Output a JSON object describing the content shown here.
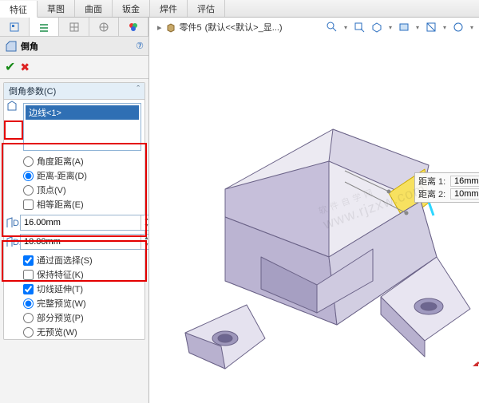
{
  "tabs": {
    "items": [
      "特征",
      "草图",
      "曲面",
      "钣金",
      "焊件",
      "评估"
    ],
    "active_index": 0
  },
  "pm": {
    "title": "倒角",
    "ok_tip": "OK",
    "cancel_tip": "Cancel",
    "help_char": "⑦",
    "group_header": "倒角参数(C)",
    "selection": {
      "items": [
        "边线<1>"
      ]
    },
    "type_options": {
      "angle_dist": "角度距离(A)",
      "dist_dist": "距离-距离(D)",
      "vertex": "顶点(V)",
      "selected": "dist_dist"
    },
    "equal_dist_label": "相等距离(E)",
    "d1": {
      "value": "16.00mm"
    },
    "d2": {
      "value": "10.00mm"
    },
    "more_opts": {
      "through_face": "通过面选择(S)",
      "keep_feat": "保持特征(K)",
      "tangent_ext": "切线延伸(T)"
    },
    "preview_opts": {
      "full": "完整预览(W)",
      "partial": "部分预览(P)",
      "none": "无预览(W)",
      "selected": "full"
    }
  },
  "breadcrumb": {
    "part": "零件5",
    "config": "(默认<<默认>_显...)"
  },
  "callout": {
    "l1_label": "距离 1:",
    "l1_value": "16mm",
    "l2_label": "距离 2:",
    "l2_value": "10mm"
  },
  "watermark_lines": [
    "软件自学网",
    "www.rjzxw.com"
  ],
  "colors": {
    "selection": "#2f6fb4",
    "highlight": "#e40000",
    "accent_preview": "#f5d400",
    "part_face_light": "#e9e6ef",
    "part_face_dark": "#b4add0",
    "part_stroke": "#6b6388"
  }
}
